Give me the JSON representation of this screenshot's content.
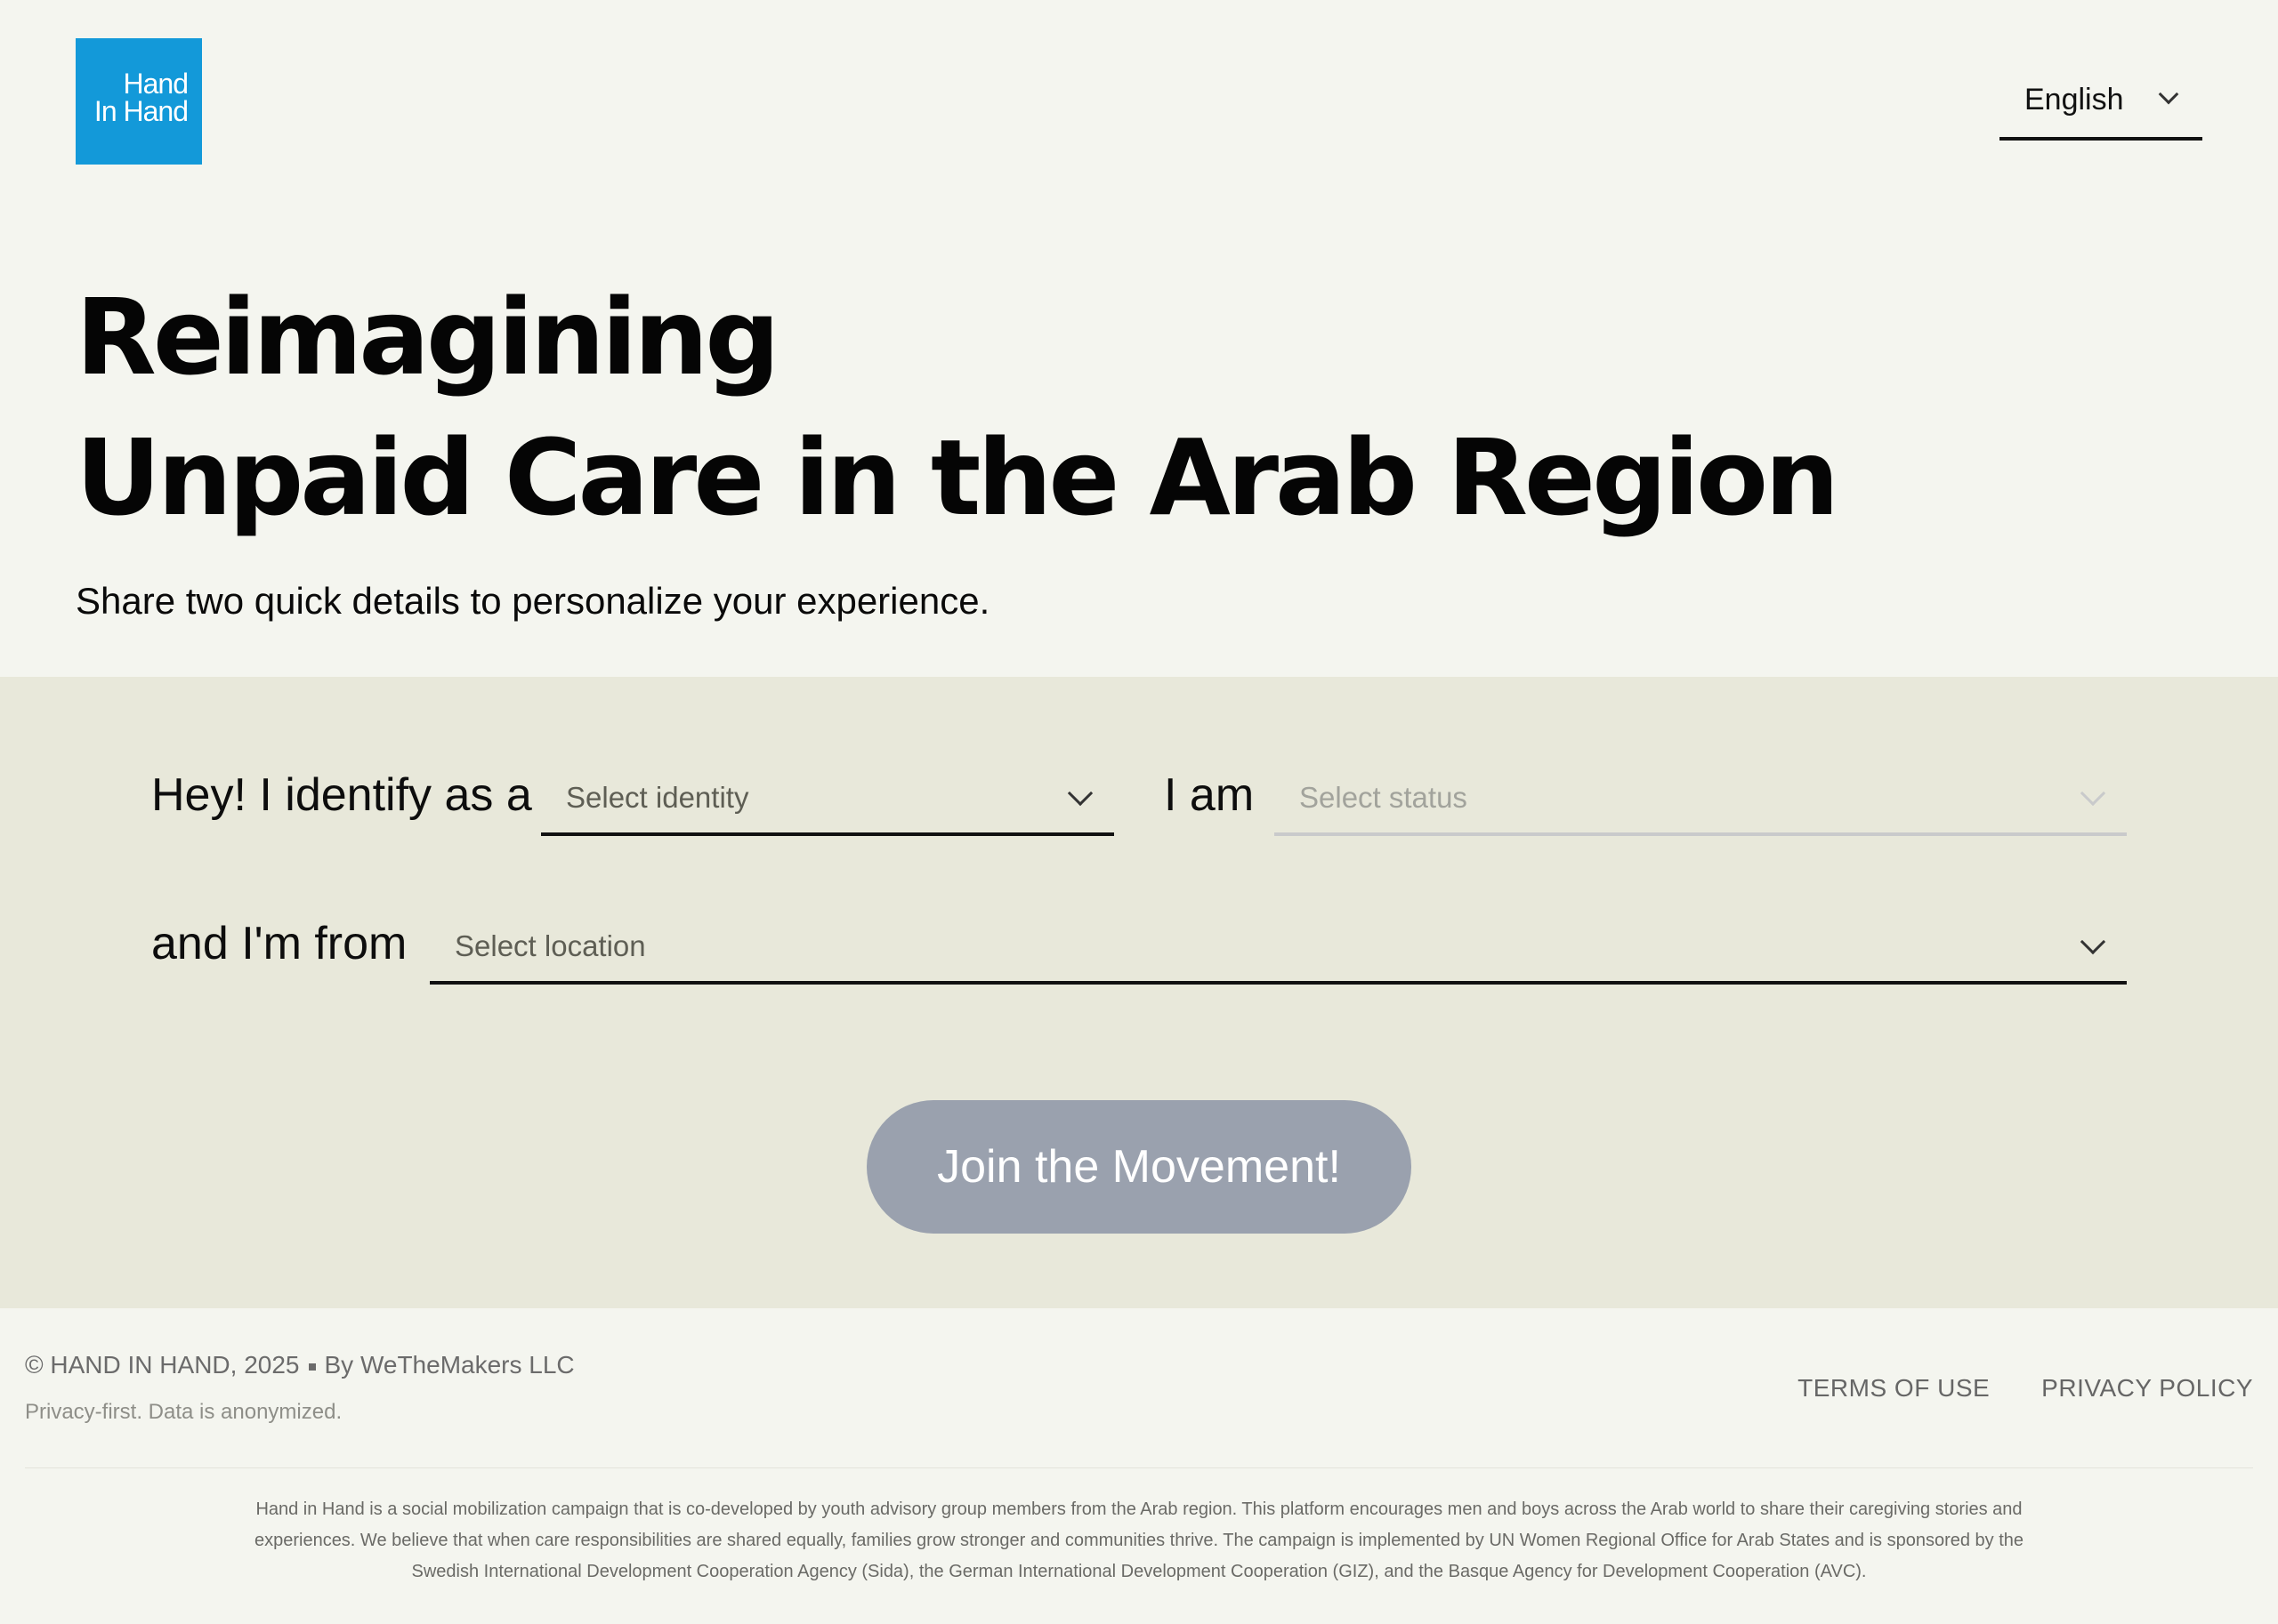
{
  "header": {
    "logo_line1": "Hand",
    "logo_line2": "In Hand",
    "language": {
      "selected": "English",
      "icon": "chevron-down-icon"
    }
  },
  "hero": {
    "title_line1": "Reimagining",
    "title_line2": "Unpaid Care in the Arab Region",
    "subtitle": "Share two quick details to personalize your experience."
  },
  "form": {
    "identity_label": "Hey! I identify as a",
    "identity_placeholder": "Select identity",
    "status_label": "I am",
    "status_placeholder": "Select status",
    "location_label": "and I'm from",
    "location_placeholder": "Select location",
    "submit_label": "Join the Movement!"
  },
  "footer": {
    "copyright": "© HAND IN HAND, 2025",
    "by": "By WeTheMakers LLC",
    "privacy_note": "Privacy-first. Data is anonymized.",
    "links": {
      "terms": "TERMS OF USE",
      "privacy": "PRIVACY POLICY"
    },
    "disclaimer": "Hand in Hand is a social mobilization campaign that is co-developed by youth advisory group members from the Arab region. This platform encourages men and boys across the Arab world to share their caregiving stories and experiences. We believe that when care responsibilities are shared equally, families grow stronger and communities thrive. The campaign is implemented by UN Women Regional Office for Arab States and is sponsored by the Swedish International Development Cooperation Agency (Sida), the German International Development Cooperation (GIZ), and the Basque Agency for Development Cooperation (AVC)."
  },
  "colors": {
    "logo_bg": "#1399d9",
    "page_bg": "#f4f5ef",
    "form_band_bg": "#e8e8da",
    "button_bg": "#9aa1ae"
  }
}
